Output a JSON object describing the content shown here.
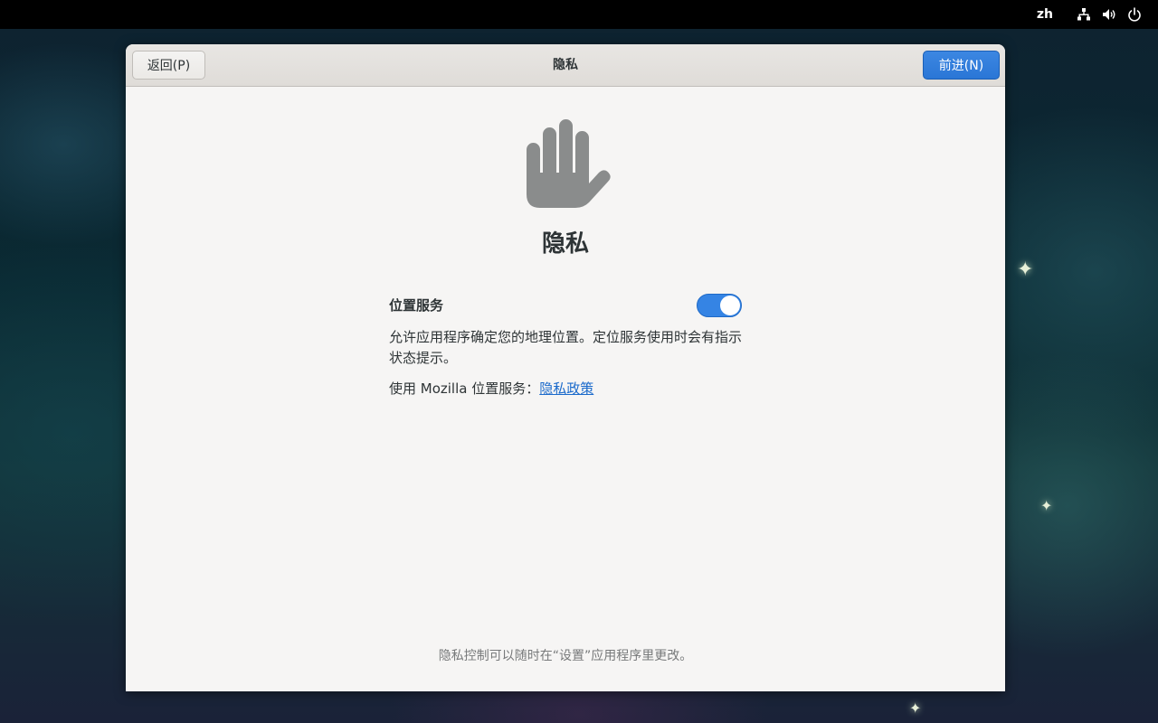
{
  "topbar": {
    "language": "zh",
    "indicators": [
      "network-icon",
      "volume-icon",
      "power-icon"
    ]
  },
  "window": {
    "title": "隐私",
    "back_label": "返回(P)",
    "next_label": "前进(N)"
  },
  "page": {
    "heading": "隐私",
    "icon": "hand-stop-icon"
  },
  "location": {
    "title": "位置服务",
    "enabled": true,
    "description": "允许应用程序确定您的地理位置。定位服务使用时会有指示状态提示。",
    "policy_prefix": "使用 Mozilla 位置服务：",
    "policy_link": "隐私政策"
  },
  "footer": {
    "note": "隐私控制可以随时在“设置”应用程序里更改。"
  },
  "colors": {
    "accent": "#3584e4",
    "link": "#1b6acb",
    "icon_gray": "#8a8c8c"
  }
}
